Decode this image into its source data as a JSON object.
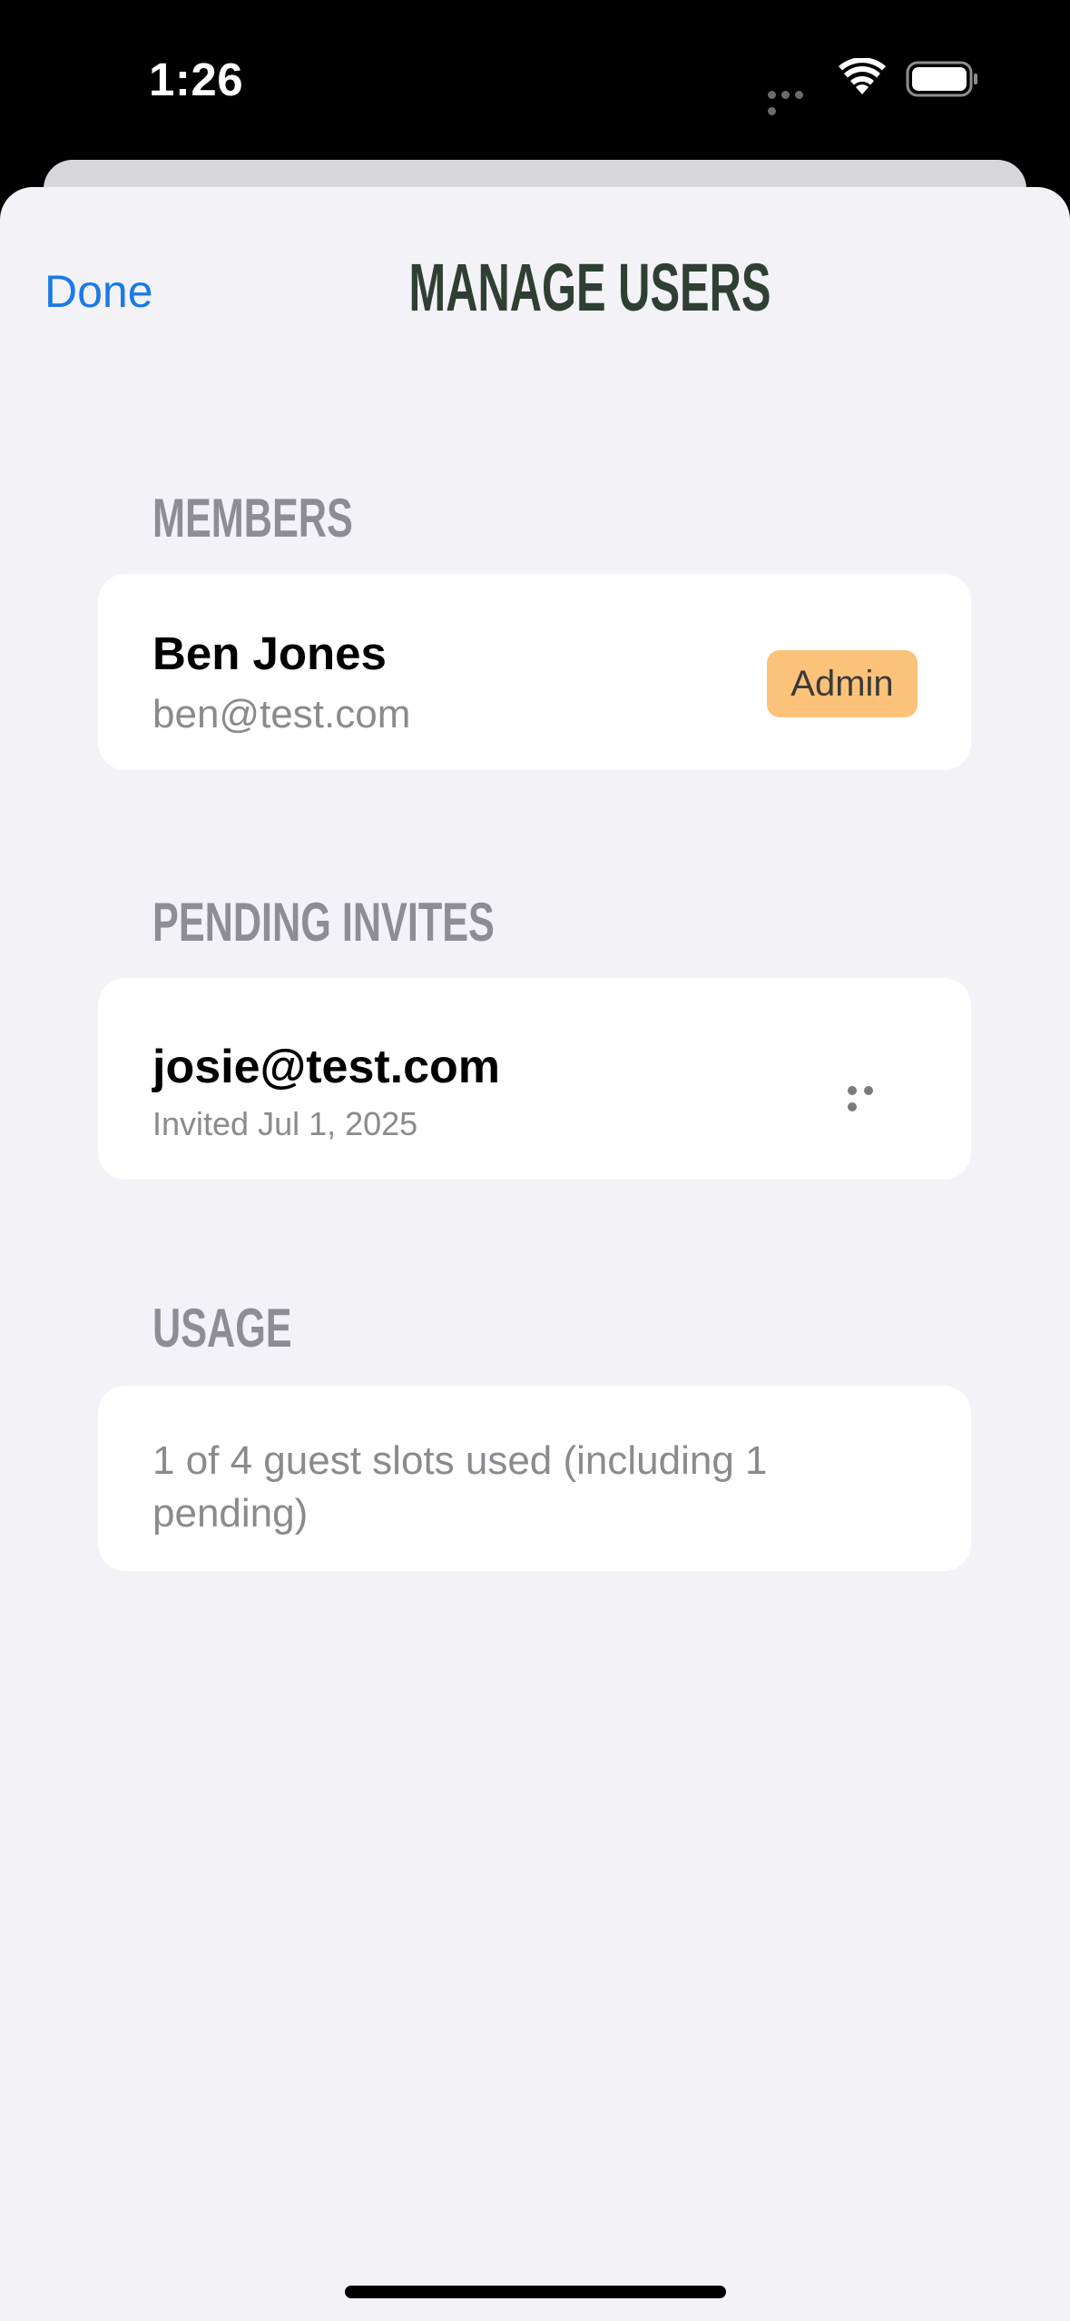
{
  "status_bar": {
    "time": "1:26",
    "icons": [
      "signal-dots-icon",
      "wifi-icon",
      "battery-icon"
    ]
  },
  "nav": {
    "done_label": "Done",
    "title": "MANAGE USERS"
  },
  "members": {
    "header": "MEMBERS",
    "items": [
      {
        "name": "Ben Jones",
        "email": "ben@test.com",
        "role": "Admin"
      }
    ]
  },
  "pending_invites": {
    "header": "PENDING INVITES",
    "items": [
      {
        "email": "josie@test.com",
        "invited": "Invited Jul 1, 2025",
        "menu_icon": "more-icon"
      }
    ]
  },
  "usage": {
    "header": "USAGE",
    "text": "1 of 4 guest slots used (including 1 pending)"
  },
  "colors": {
    "accent": "#1a7ae6",
    "title": "#2f3f33",
    "badge": "#fdc27a",
    "background": "#f2f2f7",
    "secondary_text": "#8a8a8f"
  }
}
